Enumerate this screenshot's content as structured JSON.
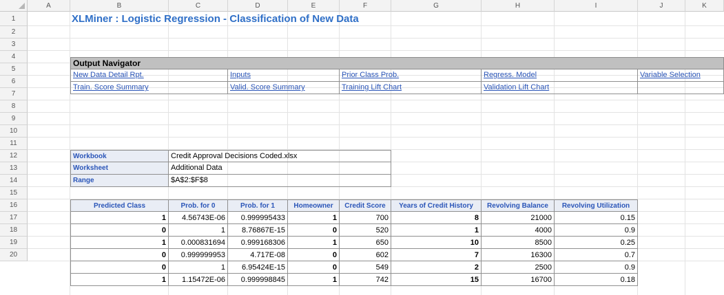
{
  "columns": [
    "A",
    "B",
    "C",
    "D",
    "E",
    "F",
    "G",
    "H",
    "I",
    "J",
    "K"
  ],
  "rows": [
    "1",
    "2",
    "3",
    "4",
    "5",
    "6",
    "7",
    "8",
    "9",
    "10",
    "11",
    "12",
    "13",
    "14",
    "15",
    "16",
    "17",
    "18",
    "19",
    "20"
  ],
  "title": "XLMiner : Logistic Regression - Classification of New Data",
  "navigator": {
    "header": "Output Navigator",
    "row1": [
      "New Data Detail Rpt.",
      "Inputs",
      "Prior Class Prob.",
      "Regress. Model",
      "Variable Selection"
    ],
    "row2": [
      "Train. Score Summary",
      "Valid. Score Summary",
      "Training Lift Chart",
      "Validation Lift Chart"
    ]
  },
  "info": {
    "workbook_label": "Workbook",
    "workbook_value": "Credit Approval Decisions Coded.xlsx",
    "worksheet_label": "Worksheet",
    "worksheet_value": "Additional Data",
    "range_label": "Range",
    "range_value": "$A$2:$F$8"
  },
  "table": {
    "headers": [
      "Predicted Class",
      "Prob. for 0",
      "Prob. for 1",
      "Homeowner",
      "Credit Score",
      "Years of Credit History",
      "Revolving Balance",
      "Revolving Utilization"
    ],
    "rows": [
      [
        "1",
        "4.56743E-06",
        "0.999995433",
        "1",
        "700",
        "8",
        "21000",
        "0.15"
      ],
      [
        "0",
        "1",
        "8.76867E-15",
        "0",
        "520",
        "1",
        "4000",
        "0.9"
      ],
      [
        "1",
        "0.000831694",
        "0.999168306",
        "1",
        "650",
        "10",
        "8500",
        "0.25"
      ],
      [
        "0",
        "0.999999953",
        "4.717E-08",
        "0",
        "602",
        "7",
        "16300",
        "0.7"
      ],
      [
        "0",
        "1",
        "6.95424E-15",
        "0",
        "549",
        "2",
        "2500",
        "0.9"
      ],
      [
        "1",
        "1.15472E-06",
        "0.999998845",
        "1",
        "742",
        "15",
        "16700",
        "0.18"
      ]
    ]
  }
}
